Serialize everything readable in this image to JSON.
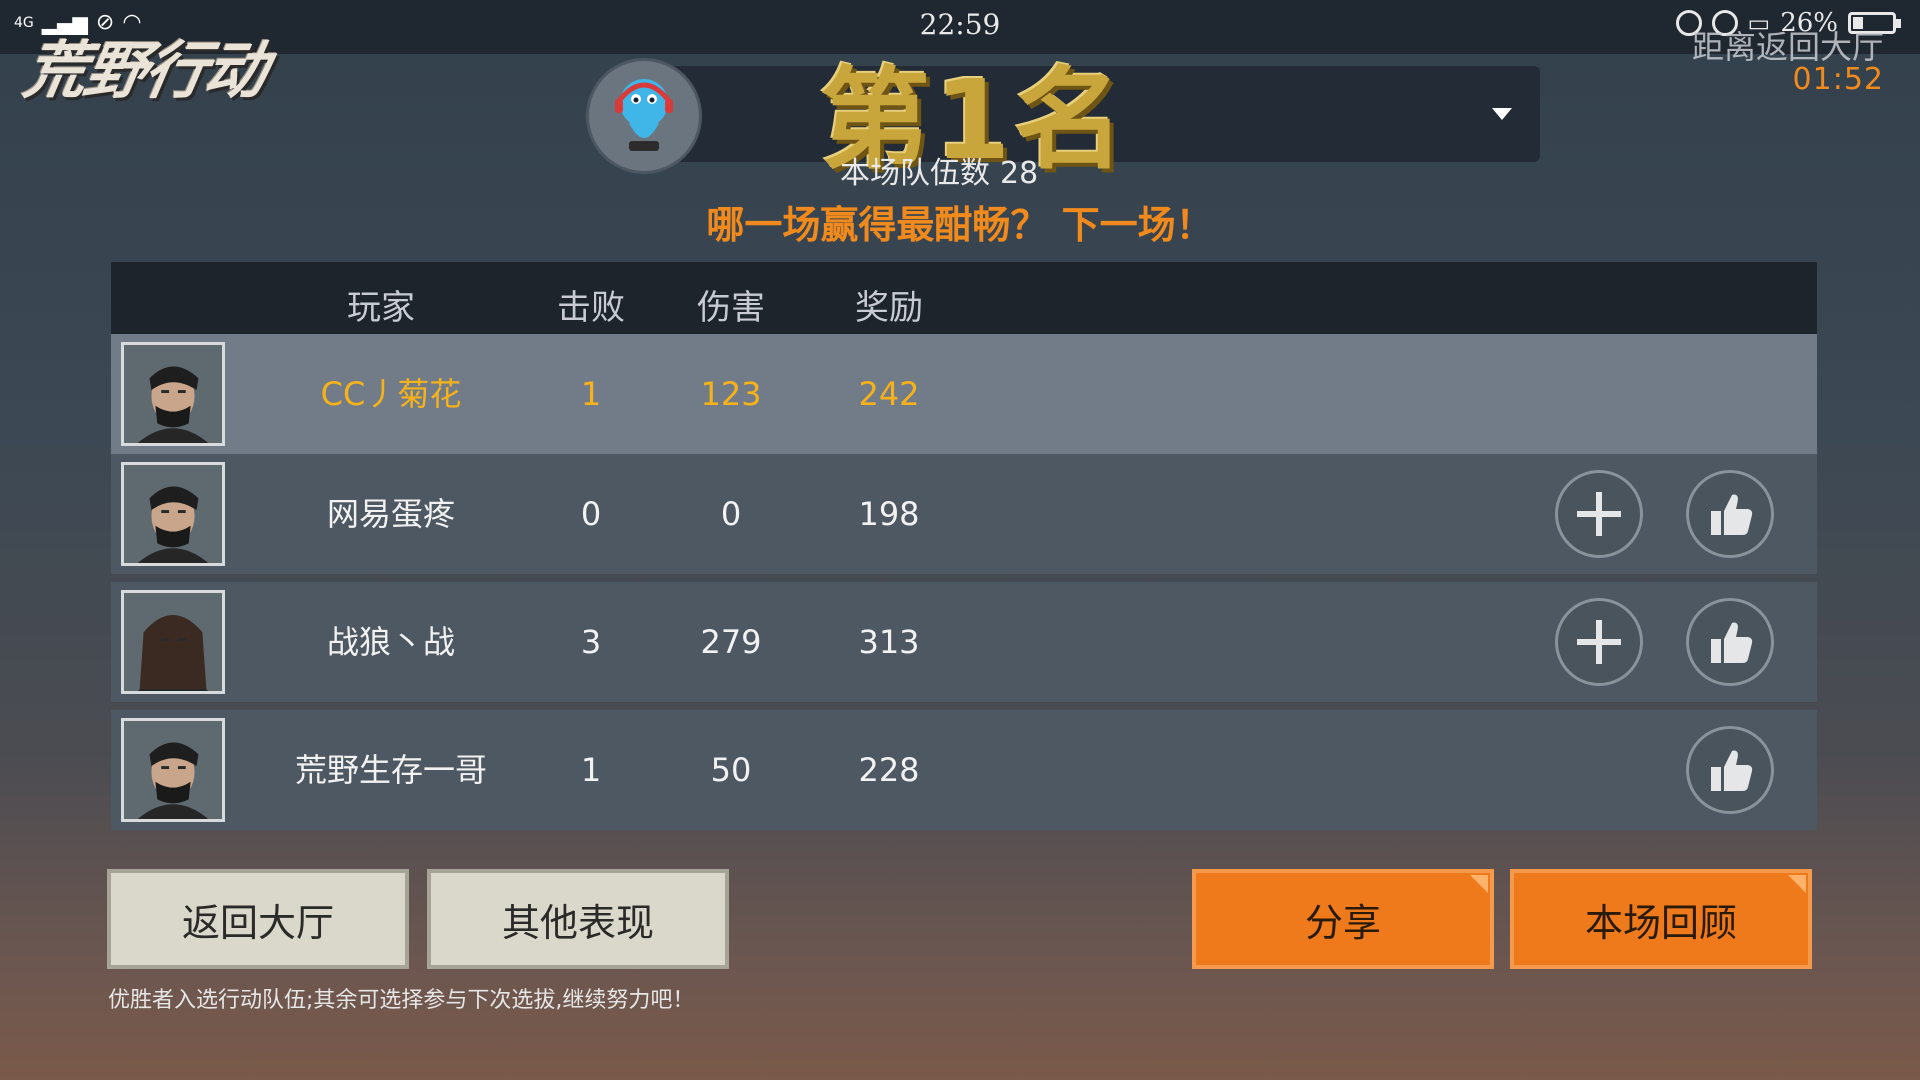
{
  "status_bar": {
    "network": "4G",
    "time": "22:59",
    "battery": "26%",
    "battery_level": 0.26
  },
  "logo": {
    "text": "荒野行动"
  },
  "countdown": {
    "label": "距离返回大厅",
    "value": "01:52"
  },
  "result": {
    "rank": "第1名",
    "team_count_label": "本场队伍数",
    "team_count": "28",
    "slogan": "哪一场赢得最酣畅？ 下一场！"
  },
  "table": {
    "headers": {
      "player": "玩家",
      "kills": "击败",
      "damage": "伤害",
      "reward": "奖励"
    },
    "rows": [
      {
        "name": "CC丿菊花",
        "kills": "1",
        "damage": "123",
        "reward": "242",
        "is_self": true,
        "add_friend": false,
        "like": false
      },
      {
        "name": "网易蛋疼",
        "kills": "0",
        "damage": "0",
        "reward": "198",
        "is_self": false,
        "add_friend": true,
        "like": true
      },
      {
        "name": "战狼丶战",
        "kills": "3",
        "damage": "279",
        "reward": "313",
        "is_self": false,
        "add_friend": true,
        "like": true
      },
      {
        "name": "荒野生存一哥",
        "kills": "1",
        "damage": "50",
        "reward": "228",
        "is_self": false,
        "add_friend": false,
        "like": true
      }
    ]
  },
  "buttons": {
    "back_lobby": "返回大厅",
    "other_performance": "其他表现",
    "share": "分享",
    "review": "本场回顾"
  },
  "footer_note": "优胜者入选行动队伍;其余可选择参与下次选拔,继续努力吧！",
  "colors": {
    "accent_orange": "#ee7a1b",
    "rank_gold": "#c9a63c",
    "self_highlight": "#f5b21a"
  },
  "icons": {
    "add_friend": "plus-icon",
    "like": "thumbs-up-icon",
    "dropdown": "chevron-down-icon"
  }
}
